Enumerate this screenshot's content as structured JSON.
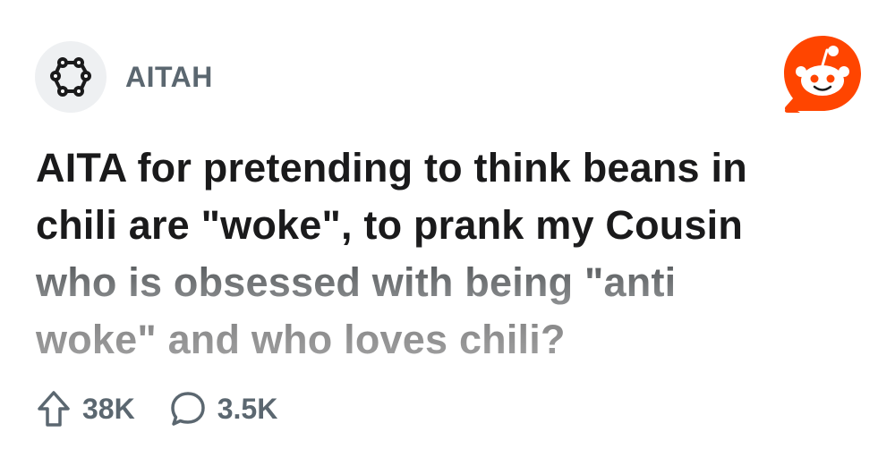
{
  "subreddit": {
    "name": "AITAH",
    "icon": "subreddit-community-icon"
  },
  "brand": {
    "icon": "reddit-snoo-logo",
    "accent": "#ff4500"
  },
  "post": {
    "title_lines": [
      "AITA for pretending to think beans in",
      "chili are \"woke\", to prank my Cousin",
      "who is obsessed with being \"anti",
      "woke\" and who loves chili?"
    ]
  },
  "stats": {
    "upvotes": "38K",
    "comments": "3.5K",
    "upvote_icon": "upvote-arrow-icon",
    "comment_icon": "comment-bubble-icon"
  },
  "colors": {
    "title": "#1a1a1b",
    "meta": "#5b6770",
    "avatar_bg": "#eef0f2"
  }
}
